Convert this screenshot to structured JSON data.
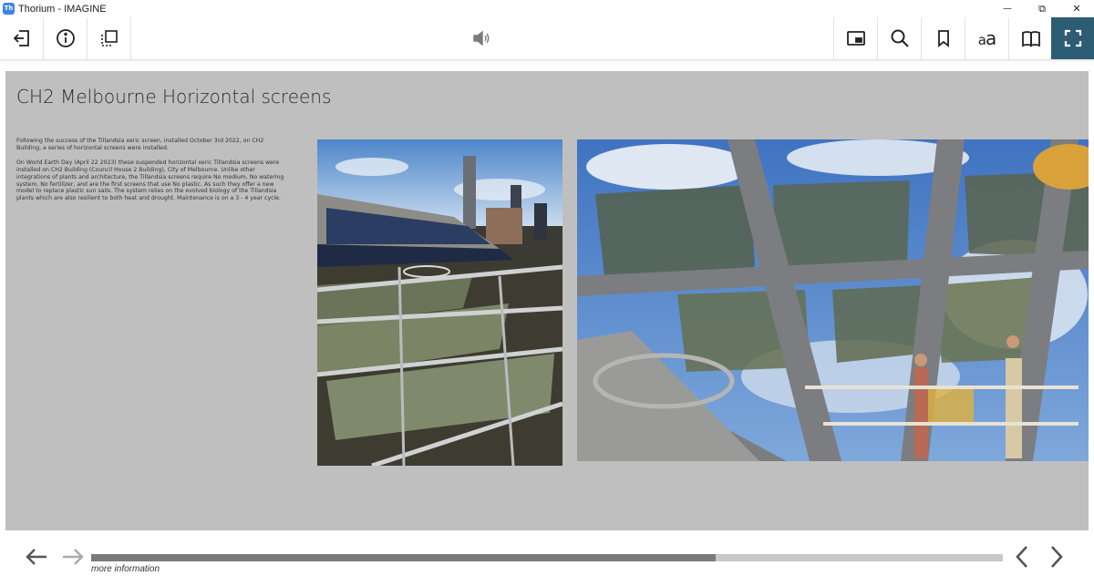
{
  "window": {
    "title": "Thorium - IMAGINE",
    "app_icon_label": "Th",
    "minimize_glyph": "—",
    "restore_glyph": "⧉",
    "close_glyph": "✕"
  },
  "toolbar": {
    "left_icons": [
      "back-to-library-icon",
      "info-icon",
      "table-of-contents-icon"
    ],
    "center_icon": "speaker-icon",
    "right_icons": [
      "picture-in-picture-icon",
      "search-icon",
      "bookmark-icon",
      "text-settings-icon",
      "reading-mode-icon",
      "fullscreen-icon"
    ],
    "text_settings_big": "a",
    "text_settings_small": "a",
    "active_color": "#2d5d73"
  },
  "page": {
    "title": "CH2 Melbourne Horizontal screens",
    "paragraphs": [
      "Following the success of the Tillandsia xeric screen, installed October 3rd 2022, on CH2 Building, a series of horizontal screens were installed.",
      "On World Earth Day (April 22 2023) these suspended horizontal xeric Tillandsia screens were installed on CH2 Building (Council House 2 Building), City of Melbourne. Unlike other integrations of plants and architecture, the Tillandsia screens require No medium, No watering system, No fertilizer, and are the first screens that use No plastic. As such they offer a new model to replace plastic sun sails. The system relies on the evolved biology of the Tillandsia plants which are also resilient to both heat and drought. Maintenance is on a 3 - 4 year cycle."
    ],
    "background_color": "#bfbfbf"
  },
  "footer": {
    "more_information": "more information",
    "progress_fraction": 0.685
  }
}
